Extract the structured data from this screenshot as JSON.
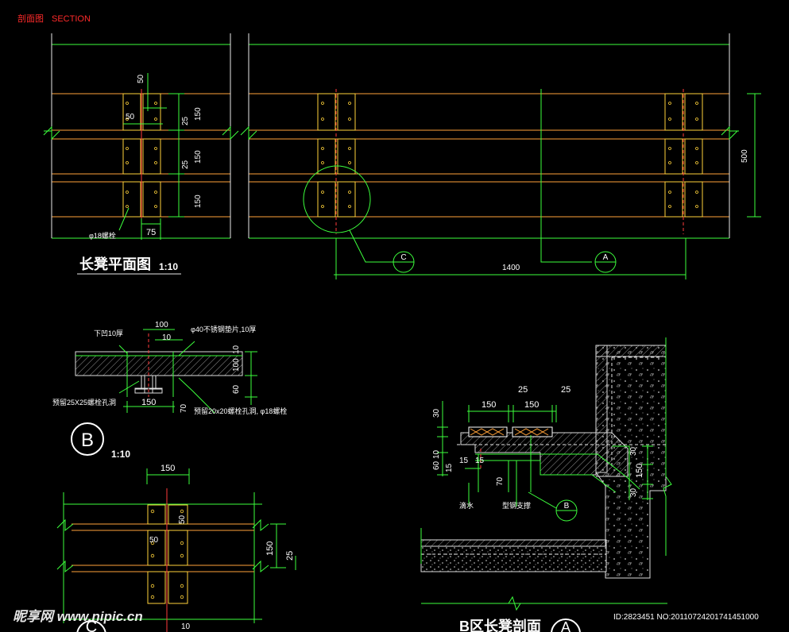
{
  "header": {
    "title_cn": "剖面图",
    "title_en": "SECTION"
  },
  "plan": {
    "title": "长凳平面图",
    "scale": "1:10",
    "dims": {
      "d50_top": "50",
      "d50_left": "50",
      "d25_a": "25",
      "d25_b": "25",
      "d150_a": "150",
      "d150_b": "150",
      "d150_c": "150",
      "d75": "75",
      "d1400": "1400",
      "d500": "500"
    },
    "bolt_label": "φ18螺栓",
    "callout_c": "C",
    "callout_a": "A"
  },
  "detail_b": {
    "label_down": "下凹10厚",
    "label_washer": "φ40不锈钢垫片,10厚",
    "label_hole_25": "预留25X25螺栓孔洞",
    "label_hole_20": "预留20x20螺栓孔洞, φ18螺栓",
    "d100": "100",
    "d10": "10",
    "d10b": "10",
    "d100b": "100",
    "d60": "60",
    "d70": "70",
    "d150": "150",
    "circle": "B",
    "scale": "1:10"
  },
  "detail_c": {
    "d150_top": "150",
    "d50": "50",
    "d50b": "50",
    "d150_right": "150",
    "d25": "25",
    "d10_bottom": "10",
    "circle": "C"
  },
  "section_b": {
    "d150_a": "150",
    "d150_b": "150",
    "d25_a": "25",
    "d25_b": "25",
    "d30": "30",
    "d60": "60",
    "d10": "10",
    "d15_a": "15",
    "d15_b": "15",
    "d15_c": "15",
    "d70": "70",
    "d30_r": "30",
    "d150_r": "150",
    "d30_rb": "30",
    "label_waterproof": "滴水",
    "label_steel": "型钢支撑",
    "callout_b": "B",
    "title": "B区长凳剖面",
    "circle": "A"
  },
  "watermark": {
    "logo": "昵享网 www.nipic.cn",
    "id": "ID:2823451 NO:20110724201741451000"
  }
}
